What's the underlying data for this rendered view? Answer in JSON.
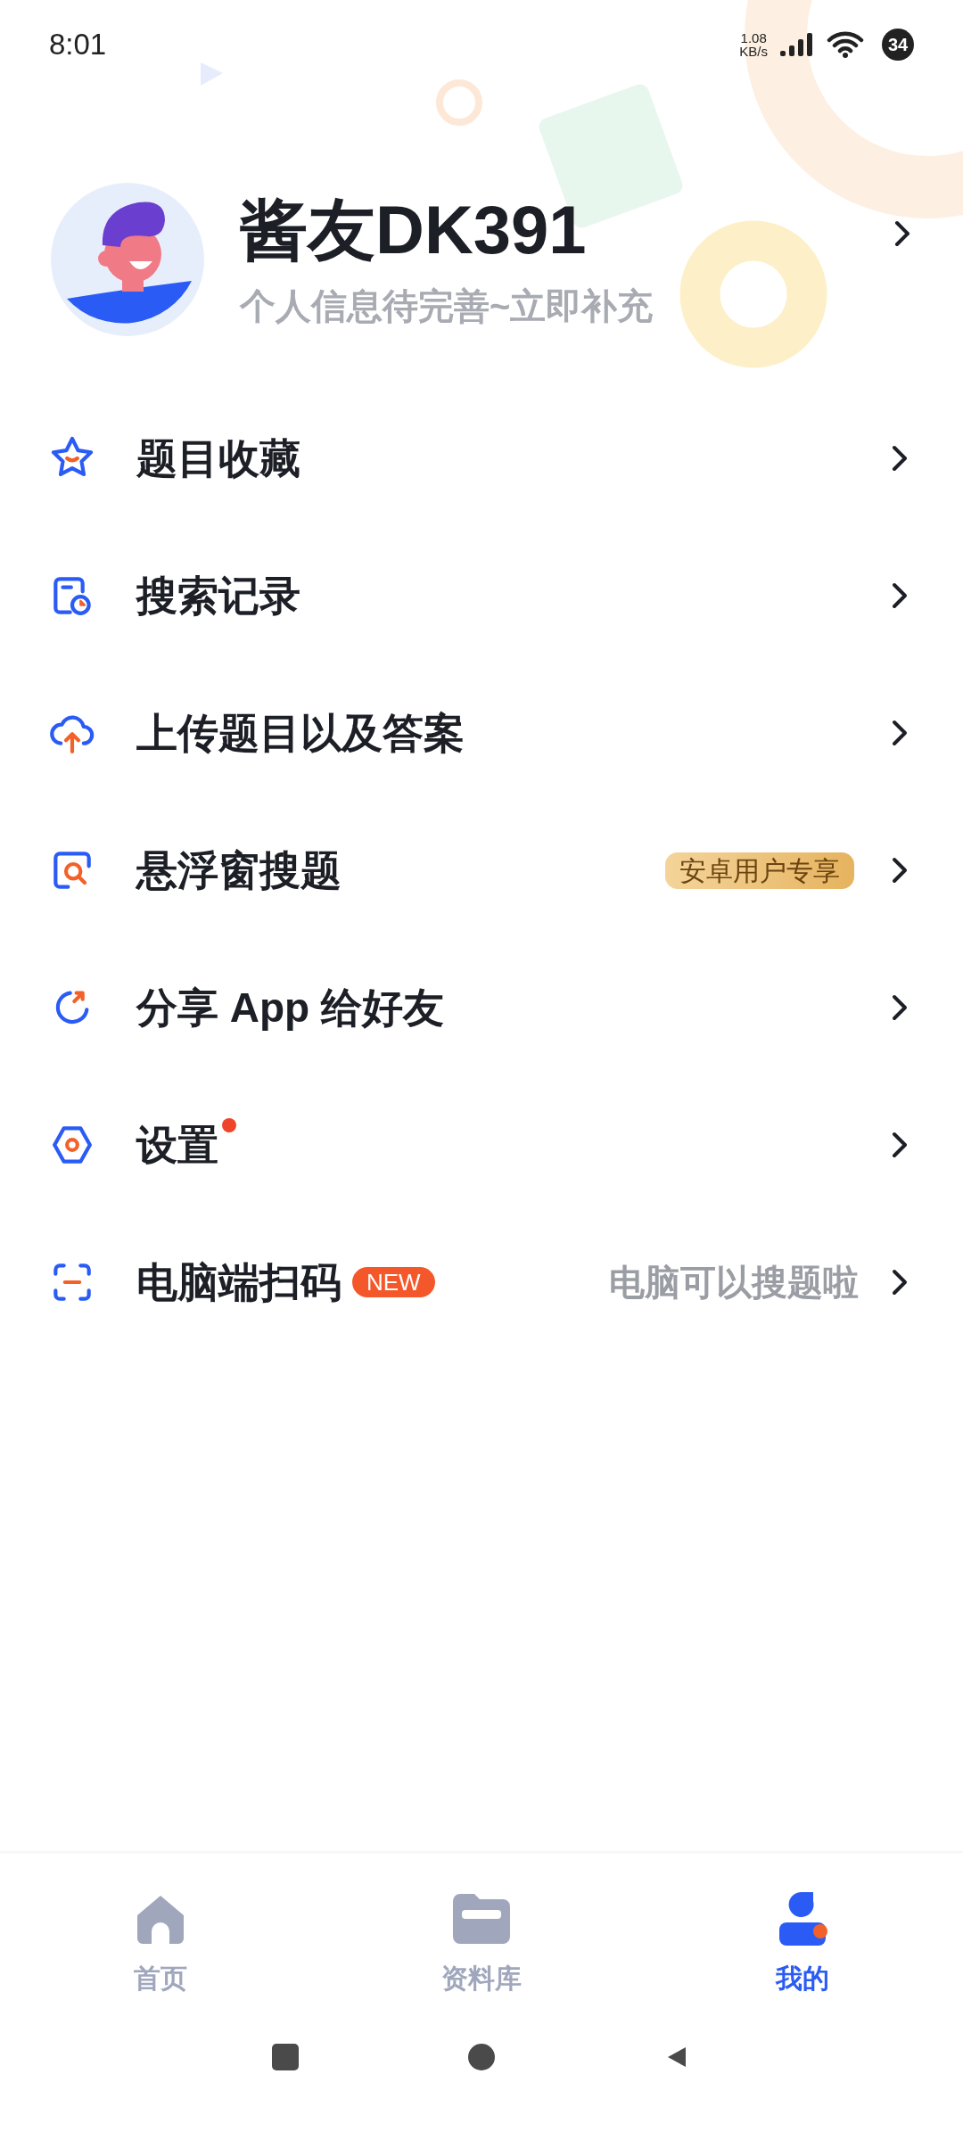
{
  "status_bar": {
    "time": "8:01",
    "speed": "1.08",
    "speed_unit": "KB/s",
    "battery": "34"
  },
  "profile": {
    "name": "酱友DK391",
    "subtitle": "个人信息待完善~立即补充"
  },
  "menu": [
    {
      "label": "题目收藏",
      "dot": false
    },
    {
      "label": "搜索记录",
      "dot": false
    },
    {
      "label": "上传题目以及答案",
      "dot": false
    },
    {
      "label": "悬浮窗搜题",
      "dot": false,
      "badge": {
        "kind": "gold",
        "text": "安卓用户专享"
      }
    },
    {
      "label": "分享 App 给好友",
      "dot": false
    },
    {
      "label": "设置",
      "dot": true
    },
    {
      "label": "电脑端扫码",
      "dot": false,
      "badge": {
        "kind": "new",
        "text": "NEW"
      },
      "hint": "电脑可以搜题啦"
    }
  ],
  "tabs": [
    {
      "label": "首页",
      "selected": false
    },
    {
      "label": "资料库",
      "selected": false
    },
    {
      "label": "我的",
      "selected": true
    }
  ]
}
